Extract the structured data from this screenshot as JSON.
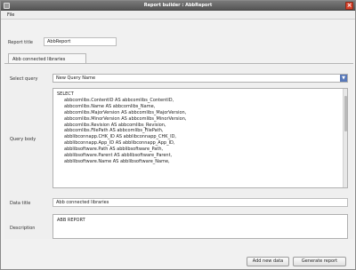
{
  "window": {
    "title": "Report builder : AbbReport"
  },
  "menu": {
    "file": "File"
  },
  "report_title": {
    "label": "Report title",
    "value": "AbbReport"
  },
  "tabs": [
    {
      "label": "Abb connected libraries"
    }
  ],
  "select_query": {
    "label": "Select query",
    "value": "New Query Name"
  },
  "query_body": {
    "label": "Query body",
    "lines": [
      "SELECT",
      "abbcomlibs.ContentID AS abbcomlibs_ContentID,",
      "abbcomlibs.Name AS abbcomlibs_Name,",
      "abbcomlibs.MajorVersion AS abbcomlibs_MajorVersion,",
      "abbcomlibs.MinorVersion AS abbcomlibs_MinorVersion,",
      "abbcomlibs.Revision AS abbcomlibs_Revision,",
      "abbcomlibs.FilePath AS abbcomlibs_FilePath,",
      "abblibconnapp.CHK_ID AS abblibconnapp_CHK_ID,",
      "abblibconnapp.App_ID AS abblibconnapp_App_ID,",
      "abblibsoftware.Path AS abblibsoftware_Path,",
      "abblibsoftware.Parent AS abblibsoftware_Parent,",
      "abblibsoftware.Name AS abblibsoftware_Name,"
    ]
  },
  "data_title": {
    "label": "Data title",
    "value": "Abb connected libraries"
  },
  "description": {
    "label": "Description",
    "value": "ABB REPORT"
  },
  "buttons": {
    "add_new_data": "Add new data",
    "generate_report": "Generate report"
  }
}
